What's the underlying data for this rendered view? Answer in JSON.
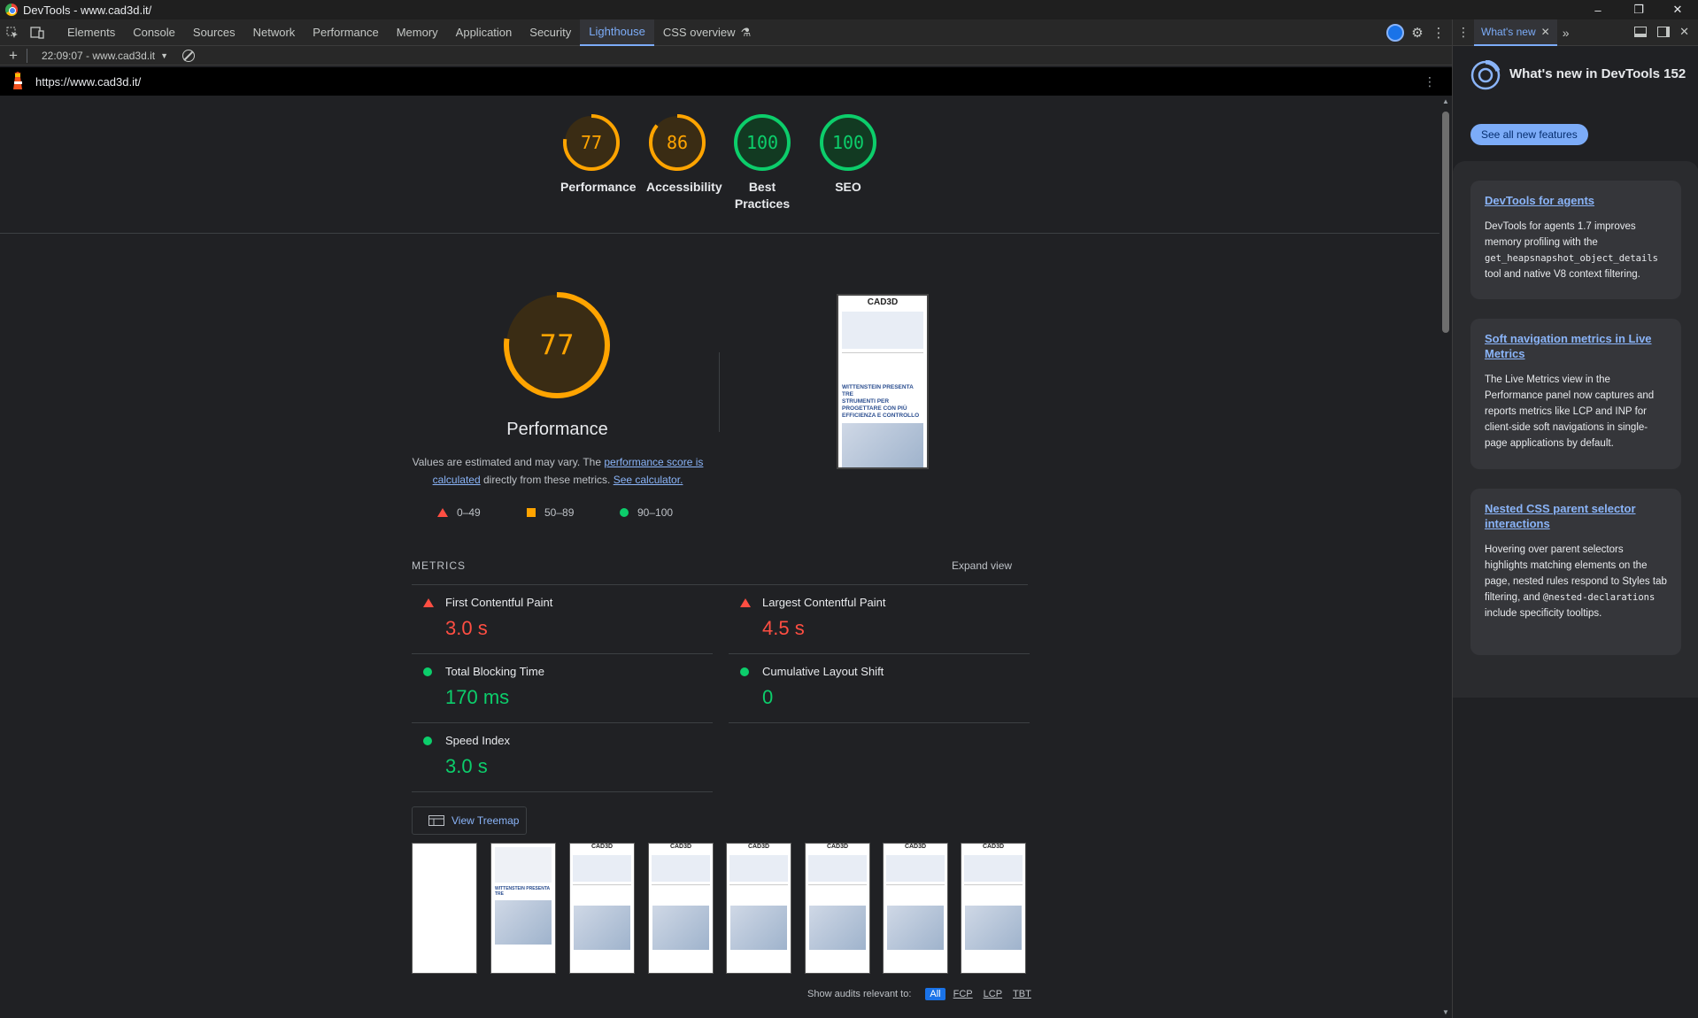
{
  "window": {
    "title": "DevTools - www.cad3d.it/"
  },
  "tabs": [
    "Elements",
    "Console",
    "Sources",
    "Network",
    "Performance",
    "Memory",
    "Application",
    "Security",
    "Lighthouse",
    "CSS overview"
  ],
  "active_tab": "Lighthouse",
  "toolbar": {
    "report_label": "22:09:07 - www.cad3d.it"
  },
  "url": "https://www.cad3d.it/",
  "scores": [
    {
      "label": "Performance",
      "value": "77"
    },
    {
      "label": "Accessibility",
      "value": "86"
    },
    {
      "label": "Best Practices",
      "label_line1": "Best",
      "label_line2": "Practices",
      "value": "100"
    },
    {
      "label": "SEO",
      "value": "100"
    }
  ],
  "performance": {
    "score": "77",
    "title": "Performance",
    "desc_prefix": "Values are estimated and may vary. The ",
    "desc_link1": "performance score is calculated",
    "desc_link1_a": "performance score is",
    "desc_link1_b": "calculated",
    "desc_middle": " directly from these metrics. ",
    "desc_link2": "See calculator."
  },
  "legend": {
    "fail": "0–49",
    "average": "50–89",
    "pass": "90–100"
  },
  "metrics_section": {
    "title": "METRICS",
    "expand": "Expand view"
  },
  "metrics": [
    {
      "label": "First Contentful Paint",
      "value": "3.0 s",
      "status": "fail"
    },
    {
      "label": "Largest Contentful Paint",
      "value": "4.5 s",
      "status": "fail"
    },
    {
      "label": "Total Blocking Time",
      "value": "170 ms",
      "status": "pass"
    },
    {
      "label": "Cumulative Layout Shift",
      "value": "0",
      "status": "pass"
    },
    {
      "label": "Speed Index",
      "value": "3.0 s",
      "status": "pass"
    }
  ],
  "treemap_button": "View Treemap",
  "thumb": {
    "logo": "CAD3D",
    "headline_1": "WITTENSTEIN PRESENTA TRE",
    "headline_2": "STRUMENTI PER",
    "headline_3": "PROGETTARE CON PIÙ",
    "headline_4": "EFFICIENZA E CONTROLLO"
  },
  "filter": {
    "label": "Show audits relevant to:",
    "options": [
      "All",
      "FCP",
      "LCP",
      "TBT"
    ]
  },
  "side": {
    "tab": "What's new",
    "heading": "What's new in DevTools 152",
    "button": "See all new features",
    "cards": [
      {
        "title": "DevTools for agents",
        "body_1": "DevTools for agents 1.7 improves memory profiling with the",
        "code_1": "get_heapsnapshot_object_details",
        "body_2": "tool and native V8 context filtering."
      },
      {
        "title": "Soft navigation metrics in Live Metrics",
        "body_1": "The Live Metrics view in the Performance panel now captures and reports metrics like LCP and INP for client-side soft navigations in single-page applications by default."
      },
      {
        "title": "Nested CSS parent selector interactions",
        "body_1": "Hovering over parent selectors highlights matching elements on the page, nested rules respond to Styles tab filtering, and",
        "code_1": "@nested-declarations",
        "body_2": "include specificity tooltips."
      }
    ]
  },
  "colors": {
    "fail": "#ff4e42",
    "average": "#ffa400",
    "pass": "#0cce6b",
    "link": "#8ab4f8"
  }
}
